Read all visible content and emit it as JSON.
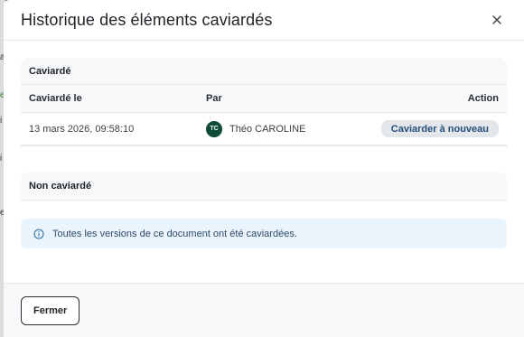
{
  "dialog": {
    "title": "Historique des éléments caviardés",
    "close_icon": "close-icon"
  },
  "redacted_section": {
    "title": "Caviardé",
    "columns": [
      "Caviardé le",
      "Par",
      "Action"
    ],
    "rows": [
      {
        "date": "13 mars 2026, 09:58:10",
        "avatar_initials": "TC",
        "user": "Théo CAROLINE",
        "action_label": "Caviarder à nouveau"
      }
    ]
  },
  "non_redacted_section": {
    "title": "Non caviardé"
  },
  "info_message": {
    "icon": "info-icon",
    "text": "Toutes les versions de ce document ont été caviardées."
  },
  "footer": {
    "close_label": "Fermer"
  },
  "colors": {
    "avatar_bg": "#0f4c3a",
    "info_bg": "#eaf4fc",
    "action_button_bg": "#e3e6ea",
    "action_button_text": "#274f7a"
  }
}
